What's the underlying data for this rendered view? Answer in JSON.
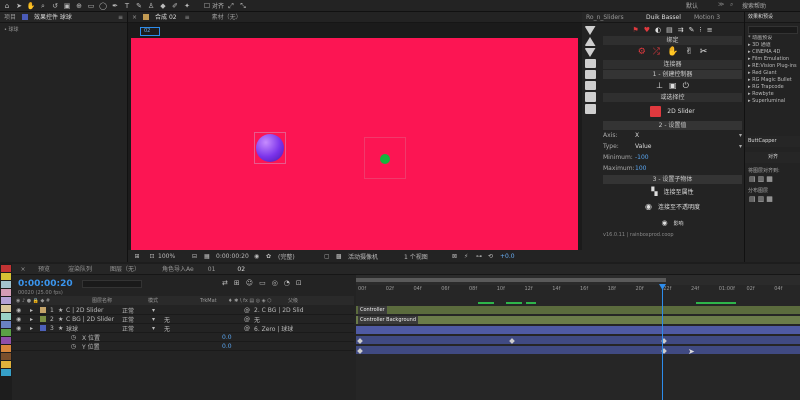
{
  "toolbar": {
    "snap_label": "对齐",
    "workspace": "默认",
    "search_label": "搜索帮助",
    "menu_glyph": "≫",
    "search_glyph": "⌕"
  },
  "left_panel": {
    "tabs": [
      "项目",
      "效果控件 球球"
    ],
    "layer_item": "• 球球"
  },
  "viewer": {
    "tabs": [
      "合成 02",
      "素材（无）"
    ],
    "comp_tab_label": "02",
    "bottom": {
      "zoom": "100%",
      "timecode": "0:00:00:20",
      "quality": "(完整)",
      "camera": "活动摄像机",
      "views": "1 个视图",
      "exposure": "+0.0"
    }
  },
  "right_panel": {
    "tabs": [
      "Ro_n_Sliders",
      "Duik Bassel",
      "Motion 3"
    ],
    "duik": {
      "section_bind": "绑定",
      "section_connect": "连接器",
      "step1": "1 - 创建控制器",
      "step_pick": "或选择控",
      "slider_label": "2D Slider",
      "step2": "2 - 设置值",
      "axis_label": "Axis:",
      "axis_value": "X",
      "type_label": "Type:",
      "type_value": "Value",
      "min_label": "Minimum:",
      "min_value": "-100",
      "max_label": "Maximum:",
      "max_value": "100",
      "step3": "3 - 设置子物体",
      "connect_props": "连接至属性",
      "connect_opacity": "连接至不透明度",
      "bottom_label": "影响",
      "version": "v16.0.11 | rainboxprod.coop"
    }
  },
  "far_right": {
    "tab": "效果和预设",
    "items": [
      "* 动画预设",
      "▸ 3D 通道",
      "▸ CINEMA 4D",
      "▸ Film Emulation",
      "▸ RE:Vision Plug-ins",
      "▸ Red Giant",
      "▸ RG Magic Bullet",
      "▸ RG Trapcode",
      "▸ Rowbyte",
      "▸ Superluminal"
    ],
    "panel2_tab": "ButtCapper",
    "align_tab": "对齐",
    "align_to": "将图层对齐到:",
    "distribute": "分布图层"
  },
  "timeline": {
    "tabs": [
      "预览",
      "渲染队列",
      "图层（无）",
      "角色导入Ae",
      "01",
      "02"
    ],
    "timecode": "0:00:00:20",
    "fps": "00020 (25.00 fps)",
    "columns": {
      "layer_name": "图层名称",
      "mode": "模式",
      "trkmat": "TrkMat",
      "parent": "父级"
    },
    "layers": [
      {
        "num": "1",
        "name": "C | 2D Slider",
        "mode": "正常",
        "trk": "",
        "parent": "2. C BG | 2D Slid",
        "color": "#c5a46a"
      },
      {
        "num": "2",
        "name": "C BG | 2D Slider",
        "mode": "正常",
        "trk": "无",
        "parent": "无",
        "color": "#7a8f43"
      },
      {
        "num": "3",
        "name": "球球",
        "mode": "正常",
        "trk": "无",
        "parent": "6. Zero | 球球",
        "color": "#4d61b9"
      }
    ],
    "sub_props": [
      {
        "name": "X 位置",
        "value": "0.0"
      },
      {
        "name": "Y 位置",
        "value": "0.0"
      }
    ],
    "ruler": [
      "00f",
      "02f",
      "04f",
      "06f",
      "08f",
      "10f",
      "12f",
      "14f",
      "16f",
      "18f",
      "20f",
      "22f",
      "24f",
      "01:00f",
      "02f",
      "04f"
    ],
    "bar_labels": [
      "Controller",
      "Controller Background"
    ],
    "swatch_colors": [
      "#c23434",
      "#d6c234",
      "#a3c4cf",
      "#d49db5",
      "#b4a2d6",
      "#d9c89c",
      "#9ad3c8",
      "#6a82c2",
      "#5aa046",
      "#8e4fa9",
      "#d8863b",
      "#7a4f2c",
      "#e0b23b",
      "#36a0c8"
    ]
  },
  "colors": {
    "comp_bg": "#fc1553",
    "accent_blue": "#2d8ceb",
    "ball_purple": "#7a33ea",
    "dot_green": "#13b53c"
  }
}
